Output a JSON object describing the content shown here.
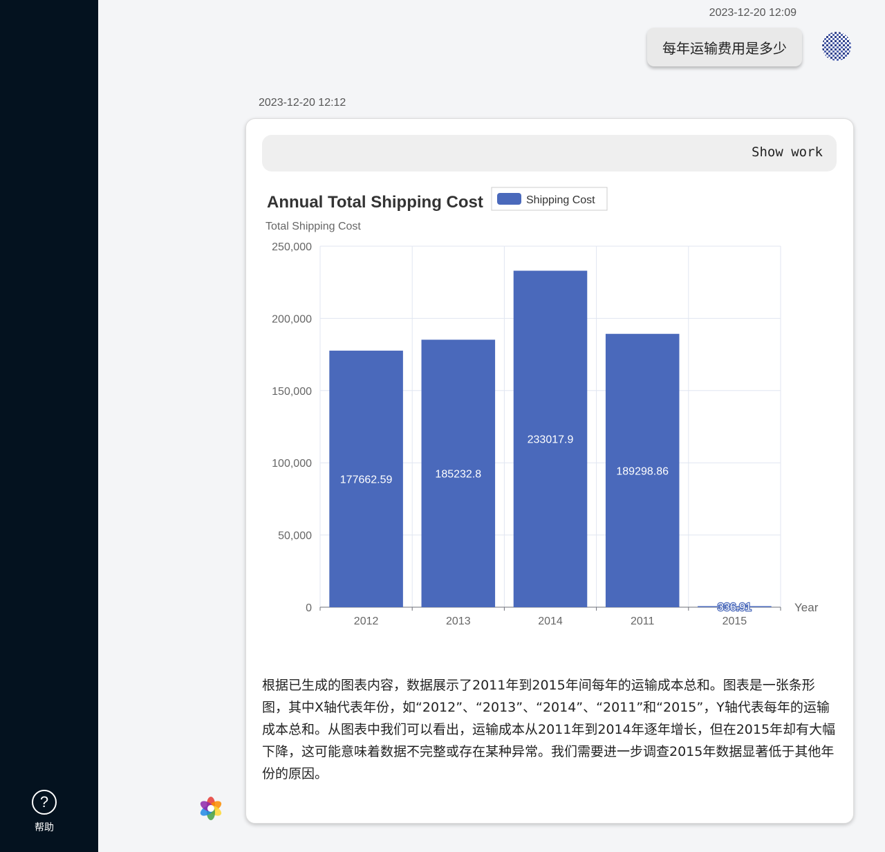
{
  "sidebar": {
    "help_label": "帮助",
    "help_glyph": "?"
  },
  "conversation": {
    "user_message": {
      "timestamp": "2023-12-20 12:09",
      "text": "每年运输费用是多少"
    },
    "bot_message": {
      "timestamp": "2023-12-20 12:12",
      "show_work_label": "Show work",
      "summary": "根据已生成的图表内容，数据展示了2011年到2015年间每年的运输成本总和。图表是一张条形图，其中X轴代表年份，如“2012”、“2013”、“2014”、“2011”和“2015”，Y轴代表每年的运输成本总和。从图表中我们可以看出，运输成本从2011年到2014年逐年增长，但在2015年却有大幅下降，这可能意味着数据不完整或存在某种异常。我们需要进一步调查2015年数据显著低于其他年份的原因。"
    }
  },
  "chart_data": {
    "type": "bar",
    "title": "Annual Total Shipping Cost",
    "ylabel": "Total Shipping Cost",
    "xlabel": "Year",
    "categories": [
      "2012",
      "2013",
      "2014",
      "2011",
      "2015"
    ],
    "series": [
      {
        "name": "Shipping Cost",
        "values": [
          177662.59,
          185232.8,
          233017.9,
          189298.86,
          336.91
        ],
        "color": "#4a69bb"
      }
    ],
    "data_labels": [
      "177662.59",
      "185232.8",
      "233017.9",
      "189298.86",
      "336.91"
    ],
    "ylim": [
      0,
      250000
    ],
    "yticks": [
      0,
      50000,
      100000,
      150000,
      200000,
      250000
    ],
    "ytick_labels": [
      "0",
      "50,000",
      "100,000",
      "150,000",
      "200,000",
      "250,000"
    ],
    "grid": true,
    "legend_position": "top"
  },
  "colors": {
    "sidebar_bg": "#04121f",
    "bar": "#4a69bb",
    "grid": "#e0e6f1"
  }
}
